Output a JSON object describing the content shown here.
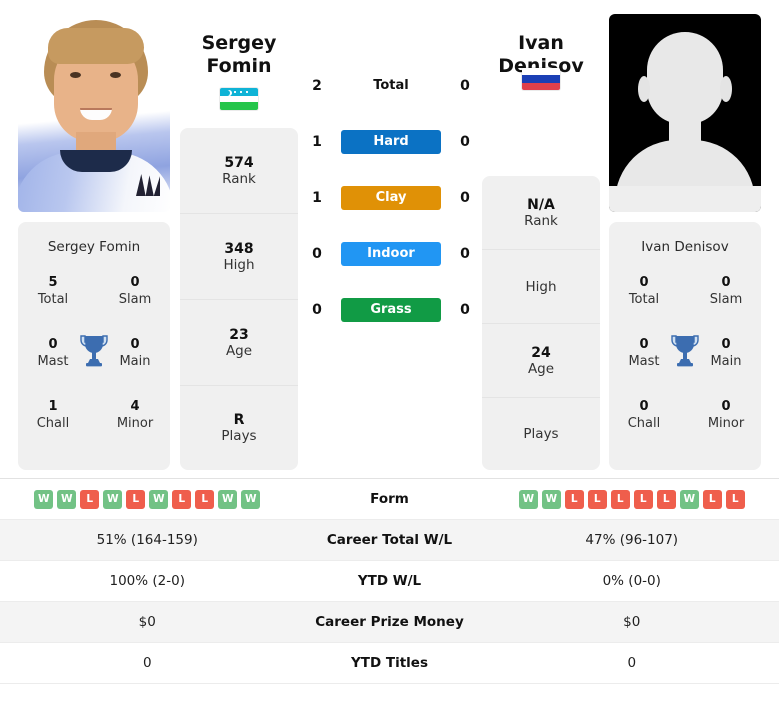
{
  "players": {
    "left": {
      "first_name": "Sergey",
      "last_name": "Fomin",
      "headline": "Sergey\nFomin",
      "card_name": "Sergey Fomin",
      "flag": "uzbekistan-flag",
      "photo": "player-photo",
      "rank": "574",
      "rank_label": "Rank",
      "high": "348",
      "high_label": "High",
      "age": "23",
      "age_label": "Age",
      "plays": "R",
      "plays_label": "Plays",
      "titles": {
        "total": "5",
        "total_label": "Total",
        "slam": "0",
        "slam_label": "Slam",
        "mast": "0",
        "mast_label": "Mast",
        "main": "0",
        "main_label": "Main",
        "chall": "1",
        "chall_label": "Chall",
        "minor": "4",
        "minor_label": "Minor"
      },
      "form": [
        "W",
        "W",
        "L",
        "W",
        "L",
        "W",
        "L",
        "L",
        "W",
        "W"
      ],
      "career_total_wl": "51% (164-159)",
      "ytd_wl": "100% (2-0)",
      "career_prize_money": "$0",
      "ytd_titles": "0"
    },
    "right": {
      "first_name": "Ivan",
      "last_name": "Denisov",
      "headline": "Ivan Denisov",
      "card_name": "Ivan Denisov",
      "flag": "russia-flag",
      "photo": "avatar-placeholder",
      "rank": "N/A",
      "rank_label": "Rank",
      "high": "",
      "high_label": "High",
      "age": "24",
      "age_label": "Age",
      "plays": "",
      "plays_label": "Plays",
      "titles": {
        "total": "0",
        "total_label": "Total",
        "slam": "0",
        "slam_label": "Slam",
        "mast": "0",
        "mast_label": "Mast",
        "main": "0",
        "main_label": "Main",
        "chall": "0",
        "chall_label": "Chall",
        "minor": "0",
        "minor_label": "Minor"
      },
      "form": [
        "W",
        "W",
        "L",
        "L",
        "L",
        "L",
        "L",
        "W",
        "L",
        "L"
      ],
      "career_total_wl": "47% (96-107)",
      "ytd_wl": "0% (0-0)",
      "career_prize_money": "$0",
      "ytd_titles": "0"
    }
  },
  "head_to_head": {
    "rows": [
      {
        "label": "Total",
        "left": "2",
        "right": "0",
        "style": "plain",
        "color": ""
      },
      {
        "label": "Hard",
        "left": "1",
        "right": "0",
        "style": "pill",
        "color": "#0b72c4"
      },
      {
        "label": "Clay",
        "left": "1",
        "right": "0",
        "style": "pill",
        "color": "#e09106"
      },
      {
        "label": "Indoor",
        "left": "0",
        "right": "0",
        "style": "pill",
        "color": "#2196f3"
      },
      {
        "label": "Grass",
        "left": "0",
        "right": "0",
        "style": "pill",
        "color": "#119b45"
      }
    ]
  },
  "stats_table": {
    "rows": [
      {
        "label": "Form",
        "left": "",
        "right": "",
        "type": "form"
      },
      {
        "label": "Career Total W/L",
        "left": "51% (164-159)",
        "right": "47% (96-107)",
        "type": "text"
      },
      {
        "label": "YTD W/L",
        "left": "100% (2-0)",
        "right": "0% (0-0)",
        "type": "text"
      },
      {
        "label": "Career Prize Money",
        "left": "$0",
        "right": "$0",
        "type": "text"
      },
      {
        "label": "YTD Titles",
        "left": "0",
        "right": "0",
        "type": "text"
      }
    ]
  },
  "colors": {
    "hard": "#0b72c4",
    "clay": "#e09106",
    "indoor": "#2196f3",
    "grass": "#119b45",
    "win_badge": "#72c285",
    "loss_badge": "#ef5e4c",
    "card_bg": "#f0f0f0",
    "row_alt_bg": "#f4f4f4",
    "trophy": "#3c6db0"
  }
}
